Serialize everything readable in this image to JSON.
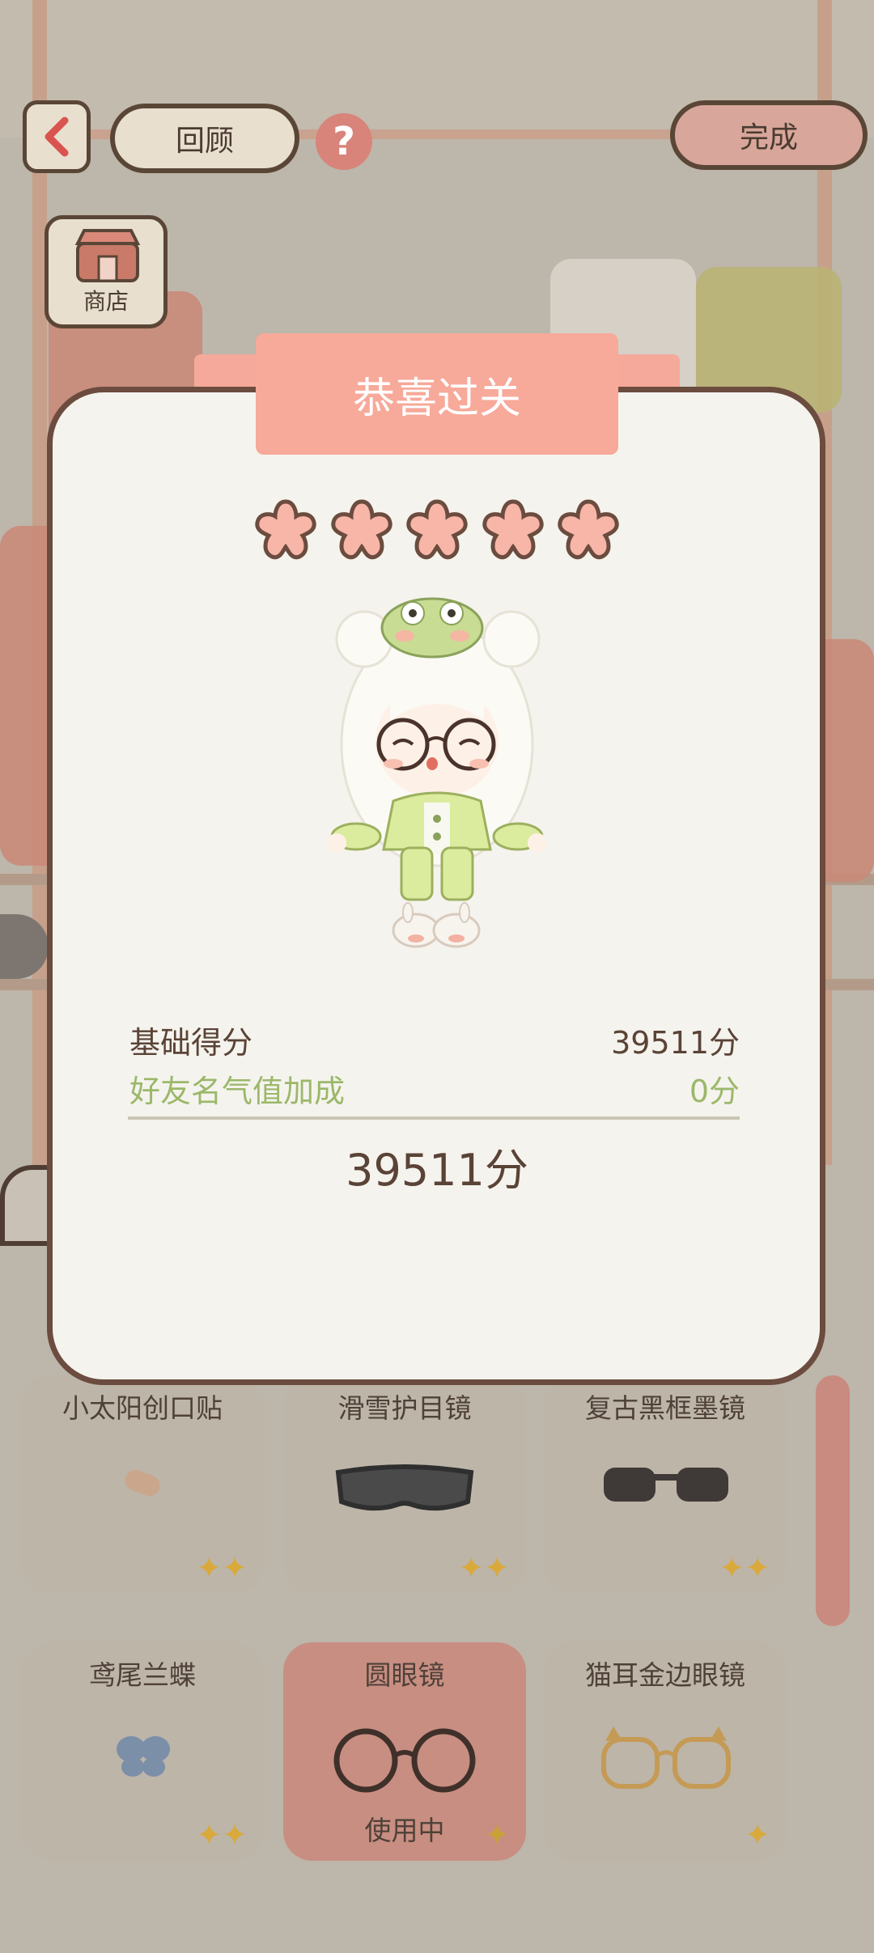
{
  "top_bar": {
    "review_label": "回顾",
    "help_label": "?",
    "done_label": "完成",
    "shop_label": "商店"
  },
  "modal": {
    "title": "恭喜过关",
    "star_count": 5,
    "base_score_label": "基础得分",
    "base_score_value": "39511分",
    "friend_bonus_label": "好友名气值加成",
    "friend_bonus_value": "0分",
    "total_score": "39511分",
    "colors": {
      "ribbon": "#f7a99a",
      "bonus_text": "#9bb86a",
      "border": "#6b4c3e"
    }
  },
  "grid": {
    "items": [
      {
        "label": "小太阳创口贴"
      },
      {
        "label": "滑雪护目镜"
      },
      {
        "label": "复古黑框墨镜"
      },
      {
        "label": "鸢尾兰蝶"
      },
      {
        "label": "圆眼镜",
        "status": "使用中"
      },
      {
        "label": "猫耳金边眼镜"
      }
    ]
  }
}
